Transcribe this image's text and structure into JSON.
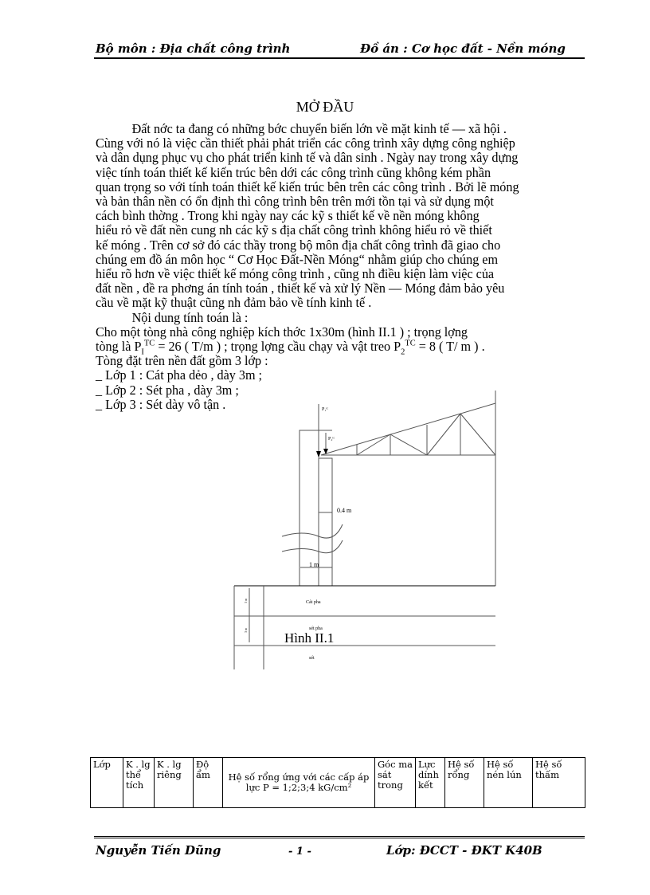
{
  "header": {
    "left": "Bộ môn : Địa chất công trình",
    "right": "Đồ án : Cơ học đất - Nền móng"
  },
  "title": "MỞ ĐẦU",
  "intro_lines": [
    "Đất nớc  ta đang có những bớc  chuyển biến lớn về mặt kinh tế — xã hội .",
    "Cùng với nó là việc cần thiết phải phát triển các công trình xây dựng công nghiệp",
    "và dân dụng phục vụ cho phát triển kinh tế và dân sinh . Ngày nay trong xây dựng",
    "việc tính toán thiết kế kiến trúc bên dới  các công trình cũng không kém phần",
    "quan trọng so với tính toán thiết kế kiến trúc bên trên các công trình . Bởi lẽ móng",
    "và bản thân nền có ổn định thì công trình bên trên mới tồn tại và sử dụng một",
    "cách bình thờng  . Trong khi ngày nay các kỹ s  thiết kế về nền móng không",
    "hiểu rỏ về đất nền cung nh  các kỹ s  địa chất công trình không hiểu rỏ về thiết",
    "kế móng . Trên cơ sở đó các thầy trong bộ môn địa chất công trình đã giao cho",
    "chúng em đồ án môn học “ Cơ Học Đất-Nền Móng“ nhằm giúp cho chúng em",
    "hiểu rõ hơn về việc thiết kế móng công trình , cũng nh  điều kiện làm việc của",
    "đất nền , đề ra phơng  án tính toán , thiết kế và xử lý Nền — Móng đảm bảo yêu",
    "cầu về mặt kỹ thuật cũng nh  đảm bảo về tính kinh tế ."
  ],
  "content_heading": "Nội dung tính toán là :",
  "problem": {
    "line1": "Cho một tòng  nhà công nghiệp kích thớc  1x30m (hình II.1 ) ; trọng lợng",
    "line2_a": "tòng  là P",
    "p1_sub": "I",
    "p1_sup": "TC",
    "line2_b": " = 26 ( T/m ) ; trọng lợng  cầu chạy và vật treo P",
    "p2_sub": "2",
    "p2_sup": "TC",
    "line2_c": " = 8 ( T/ m ) .",
    "line3": "Tòng  đặt trên nền đất gồm 3 lớp :",
    "layers": [
      "_ Lớp 1 : Cát pha dẻo , dày 3m ;",
      "_ Lớp 2 : Sét pha , dày 3m ;",
      "_ Lớp 3 : Sét dày vô tận ."
    ]
  },
  "figure": {
    "caption": "Hình II.1",
    "p1_label": "P₁ᵗᶜ",
    "p2_label": "P₂ᵗᶜ",
    "dim_wall": "0.4 m",
    "dim_col": "1 m",
    "soil_layers": [
      "Cát pha",
      "sét pha",
      "sét"
    ],
    "layer_dims": [
      "3 m",
      "3 m"
    ]
  },
  "table": {
    "headers": [
      "Lớp",
      "K . lg thể tích",
      "K . lg riêng",
      "Độ ẩm",
      "Hệ số rổng ứng với các cấp áp lực P = 1;2;3;4 kG/cm²",
      "Góc ma sát trong",
      "Lực dính kết",
      "Hệ số rổng",
      "Hệ số nén lún",
      "Hệ số thấm"
    ]
  },
  "footer": {
    "author": "Nguyễn Tiến Dũng",
    "page": "- 1 -",
    "class": "Lớp: ĐCCT - ĐKT K40B"
  }
}
